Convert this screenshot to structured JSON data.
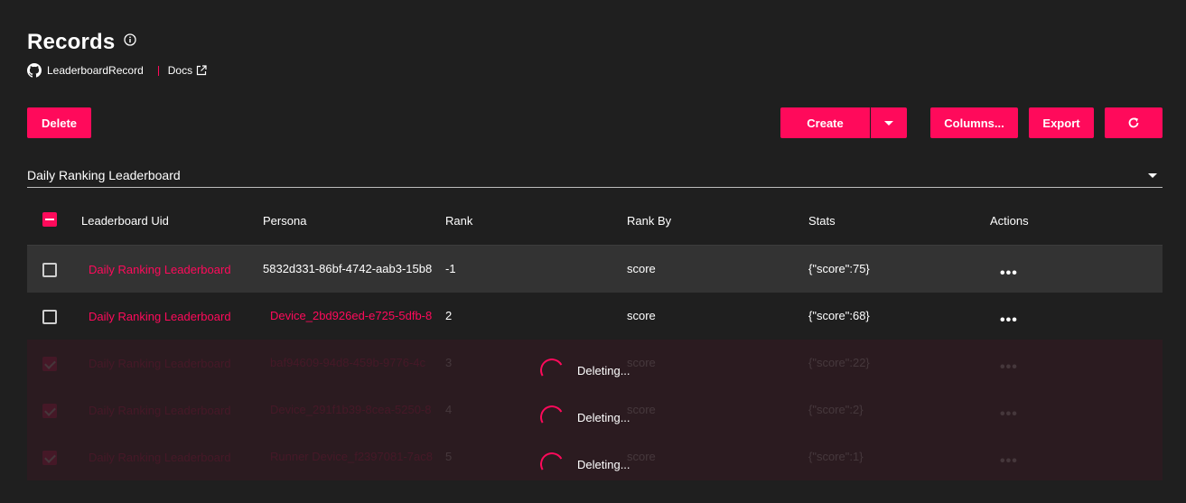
{
  "header": {
    "title": "Records",
    "repo_label": "LeaderboardRecord",
    "docs_label": "Docs"
  },
  "toolbar": {
    "delete_label": "Delete",
    "create_label": "Create",
    "columns_label": "Columns...",
    "export_label": "Export"
  },
  "leaderboard_select": {
    "value": "Daily Ranking Leaderboard"
  },
  "table": {
    "columns": [
      "Leaderboard Uid",
      "Persona",
      "Rank",
      "Rank By",
      "Stats",
      "Actions"
    ],
    "rows": [
      {
        "uid": "Daily Ranking Leaderboard",
        "persona": "5832d331-86bf-4742-aab3-15b8",
        "rank": "-1",
        "rank_by": "score",
        "stats": "{\"score\":75}",
        "checked": false,
        "state": "normal"
      },
      {
        "uid": "Daily Ranking Leaderboard",
        "persona": "Device_2bd926ed-e725-5dfb-8",
        "rank": "2",
        "rank_by": "score",
        "stats": "{\"score\":68}",
        "checked": false,
        "state": "normal"
      },
      {
        "uid": "Daily Ranking Leaderboard",
        "persona": "baf94609-94d8-459b-9776-4c",
        "rank": "3",
        "rank_by": "score",
        "stats": "{\"score\":22}",
        "checked": true,
        "state": "deleting"
      },
      {
        "uid": "Daily Ranking Leaderboard",
        "persona": "Device_291f1b39-8cea-5250-8",
        "rank": "4",
        "rank_by": "score",
        "stats": "{\"score\":2}",
        "checked": true,
        "state": "deleting"
      },
      {
        "uid": "Daily Ranking Leaderboard",
        "persona": "Runner Device_f2397081-7ac8",
        "rank": "5",
        "rank_by": "score",
        "stats": "{\"score\":1}",
        "checked": true,
        "state": "deleting"
      }
    ],
    "deleting_label": "Deleting..."
  },
  "colors": {
    "accent": "#ff0a5b",
    "background": "#1f1f1f",
    "hover_row": "#333333"
  }
}
